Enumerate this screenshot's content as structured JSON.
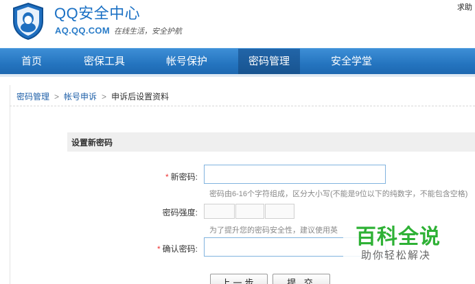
{
  "header": {
    "title": "QQ安全中心",
    "domain": "AQ.QQ.COM",
    "slogan": "在线生活，安全护航",
    "help_label": "求助",
    "brand_color": "#1a70c4"
  },
  "nav": {
    "items": [
      {
        "label": "首页",
        "active": false
      },
      {
        "label": "密保工具",
        "active": false
      },
      {
        "label": "帐号保护",
        "active": false
      },
      {
        "label": "密码管理",
        "active": true
      },
      {
        "label": "安全学堂",
        "active": false
      }
    ],
    "bg_color": "#2474bf"
  },
  "breadcrumb": {
    "items": [
      "密码管理",
      "帐号申诉"
    ],
    "current": "申诉后设置资料",
    "separator": ">"
  },
  "section": {
    "title": "设置新密码"
  },
  "form": {
    "required_mark": "*",
    "new_password_label": "新密码:",
    "new_password_value": "",
    "new_password_hint": "密码由6-16个字符组成，区分大小写(不能是9位以下的纯数字，不能包含空格)",
    "strength_label": "密码强度:",
    "strength_hint": "为了提升您的密码安全性，建议使用英",
    "confirm_label": "确认密码:",
    "confirm_value": ""
  },
  "buttons": {
    "prev_label": "上一步",
    "submit_label": "提 交"
  },
  "watermark": {
    "title": "百科全说",
    "subtitle": "助你轻松解决",
    "color": "#2eb135"
  }
}
